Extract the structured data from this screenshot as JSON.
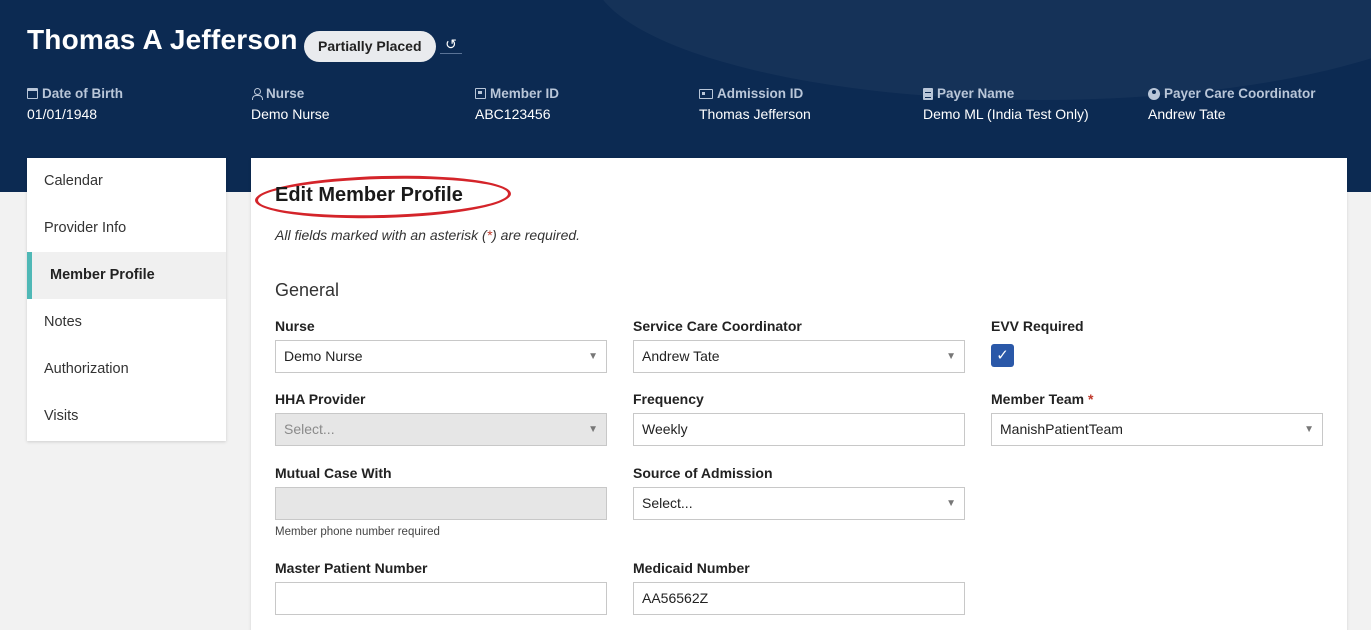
{
  "header": {
    "member_name": "Thomas A Jefferson",
    "status": "Partially Placed",
    "history_icon": "history-icon",
    "info": [
      {
        "label": "Date of Birth",
        "value": "01/01/1948",
        "icon": "calendar-icon"
      },
      {
        "label": "Nurse",
        "value": "Demo Nurse",
        "icon": "user-icon"
      },
      {
        "label": "Member ID",
        "value": "ABC123456",
        "icon": "id-badge-icon"
      },
      {
        "label": "Admission ID",
        "value": "Thomas Jefferson",
        "icon": "id-card-icon"
      },
      {
        "label": "Payer Name",
        "value": "Demo ML (India Test Only)",
        "icon": "document-icon"
      },
      {
        "label": "Payer Care Coordinator",
        "value": "Andrew Tate",
        "icon": "user-circle-icon"
      }
    ]
  },
  "sidebar": {
    "items": [
      {
        "label": "Calendar"
      },
      {
        "label": "Provider Info"
      },
      {
        "label": "Member Profile",
        "active": true
      },
      {
        "label": "Notes"
      },
      {
        "label": "Authorization"
      },
      {
        "label": "Visits"
      }
    ]
  },
  "main": {
    "title": "Edit Member Profile",
    "required_note_prefix": "All fields marked with an asterisk (",
    "required_note_star": "*",
    "required_note_suffix": ") are required.",
    "section_general": "General",
    "fields": {
      "nurse": {
        "label": "Nurse",
        "value": "Demo Nurse"
      },
      "service_care_coordinator": {
        "label": "Service Care Coordinator",
        "value": "Andrew Tate"
      },
      "evv_required": {
        "label": "EVV Required",
        "checked": true
      },
      "hha_provider": {
        "label": "HHA Provider",
        "placeholder": "Select..."
      },
      "frequency": {
        "label": "Frequency",
        "value": "Weekly"
      },
      "member_team": {
        "label": "Member Team",
        "required_mark": "*",
        "value": "ManishPatientTeam"
      },
      "mutual_case_with": {
        "label": "Mutual Case With",
        "value": "",
        "help": "Member phone number required"
      },
      "source_of_admission": {
        "label": "Source of Admission",
        "placeholder": "Select..."
      },
      "master_patient_number": {
        "label": "Master Patient Number",
        "value": ""
      },
      "medicaid_number": {
        "label": "Medicaid Number",
        "value": "AA56562Z"
      }
    }
  },
  "colors": {
    "header_bg": "#0c2a52",
    "accent_teal": "#4fb8b6",
    "checkbox_blue": "#2a58a8",
    "highlight_red": "#d4242a"
  }
}
